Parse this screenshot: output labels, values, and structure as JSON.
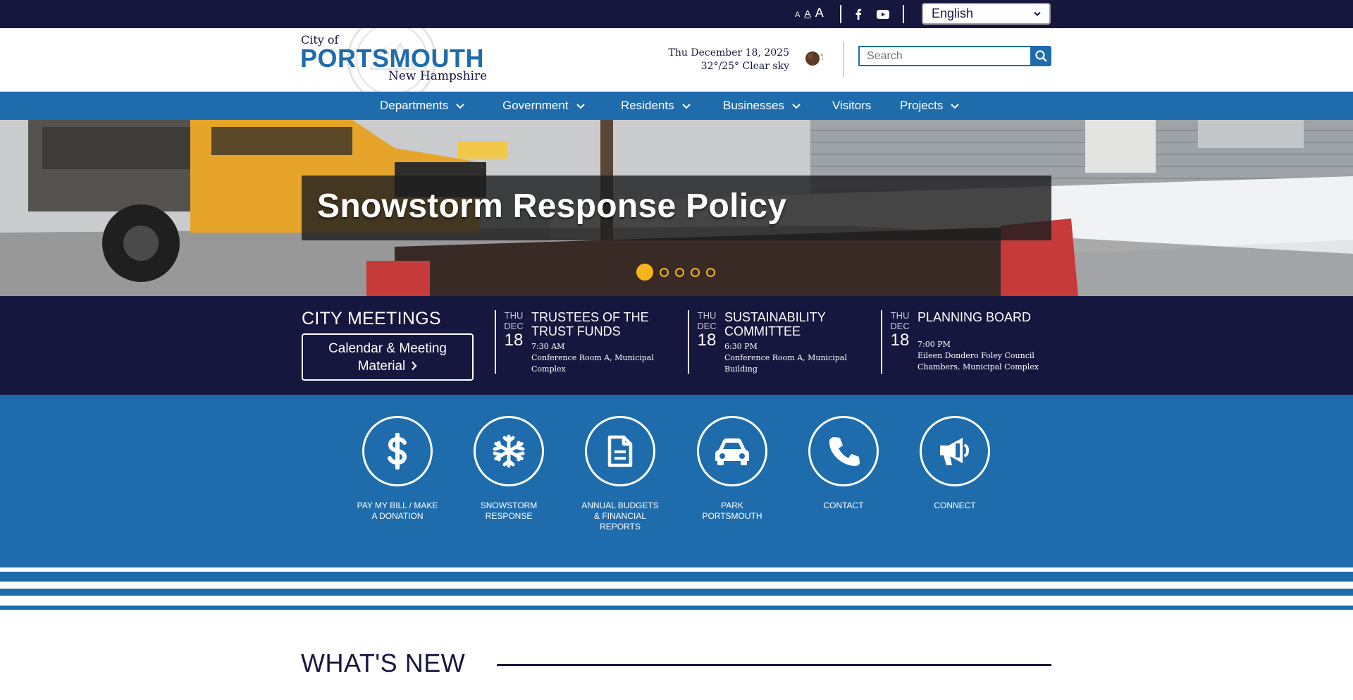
{
  "utility": {
    "font_sizes": [
      "A",
      "A",
      "A"
    ],
    "social": [
      {
        "icon": "facebook-icon",
        "label": "Facebook"
      },
      {
        "icon": "youtube-icon",
        "label": "YouTube"
      }
    ],
    "language": {
      "selected": "English"
    }
  },
  "header": {
    "logo": {
      "city_of": "City of",
      "name": "PORTSMOUTH",
      "state": "New Hampshire"
    },
    "date": "Thu December 18, 2025",
    "weather": "32°/25° Clear sky",
    "weather_icon": "clear-night-icon",
    "search": {
      "placeholder": "Search"
    }
  },
  "nav": {
    "items": [
      {
        "label": "Departments",
        "has_menu": true
      },
      {
        "label": "Government",
        "has_menu": true
      },
      {
        "label": "Residents",
        "has_menu": true
      },
      {
        "label": "Businesses",
        "has_menu": true
      },
      {
        "label": "Visitors",
        "has_menu": false
      },
      {
        "label": "Projects",
        "has_menu": true
      }
    ]
  },
  "hero": {
    "title": "Snowstorm Response Policy",
    "slide_count": 5,
    "active_slide": 1
  },
  "meetings": {
    "heading": "CITY MEETINGS",
    "button_line1": "Calendar & Meeting",
    "button_line2": "Material",
    "events": [
      {
        "dow": "THU",
        "mon": "DEC",
        "day": "18",
        "title": "TRUSTEES OF THE TRUST FUNDS",
        "time": "7:30 AM",
        "location": "Conference Room A, Municipal Complex"
      },
      {
        "dow": "THU",
        "mon": "DEC",
        "day": "18",
        "title": "SUSTAINABILITY COMMITTEE",
        "time": "6:30 PM",
        "location": "Conference Room A, Municipal Building"
      },
      {
        "dow": "THU",
        "mon": "DEC",
        "day": "18",
        "title": "PLANNING BOARD",
        "time": "7:00 PM",
        "location": "Eileen Dondero Foley Council Chambers, Municipal Complex"
      }
    ]
  },
  "quick_links": [
    {
      "label": "Pay My Bill / Make a Donation",
      "icon": "dollar-icon"
    },
    {
      "label": "Snowstorm Response",
      "icon": "snowflake-icon"
    },
    {
      "label": "Annual Budgets & Financial Reports",
      "icon": "document-icon"
    },
    {
      "label": "Park Portsmouth",
      "icon": "car-icon"
    },
    {
      "label": "Contact",
      "icon": "phone-icon"
    },
    {
      "label": "Connect",
      "icon": "megaphone-icon"
    }
  ],
  "whats_new": {
    "heading": "WHAT'S NEW"
  },
  "colors": {
    "navy": "#16173f",
    "blue": "#1f6cad",
    "accent": "#f4b41a"
  }
}
